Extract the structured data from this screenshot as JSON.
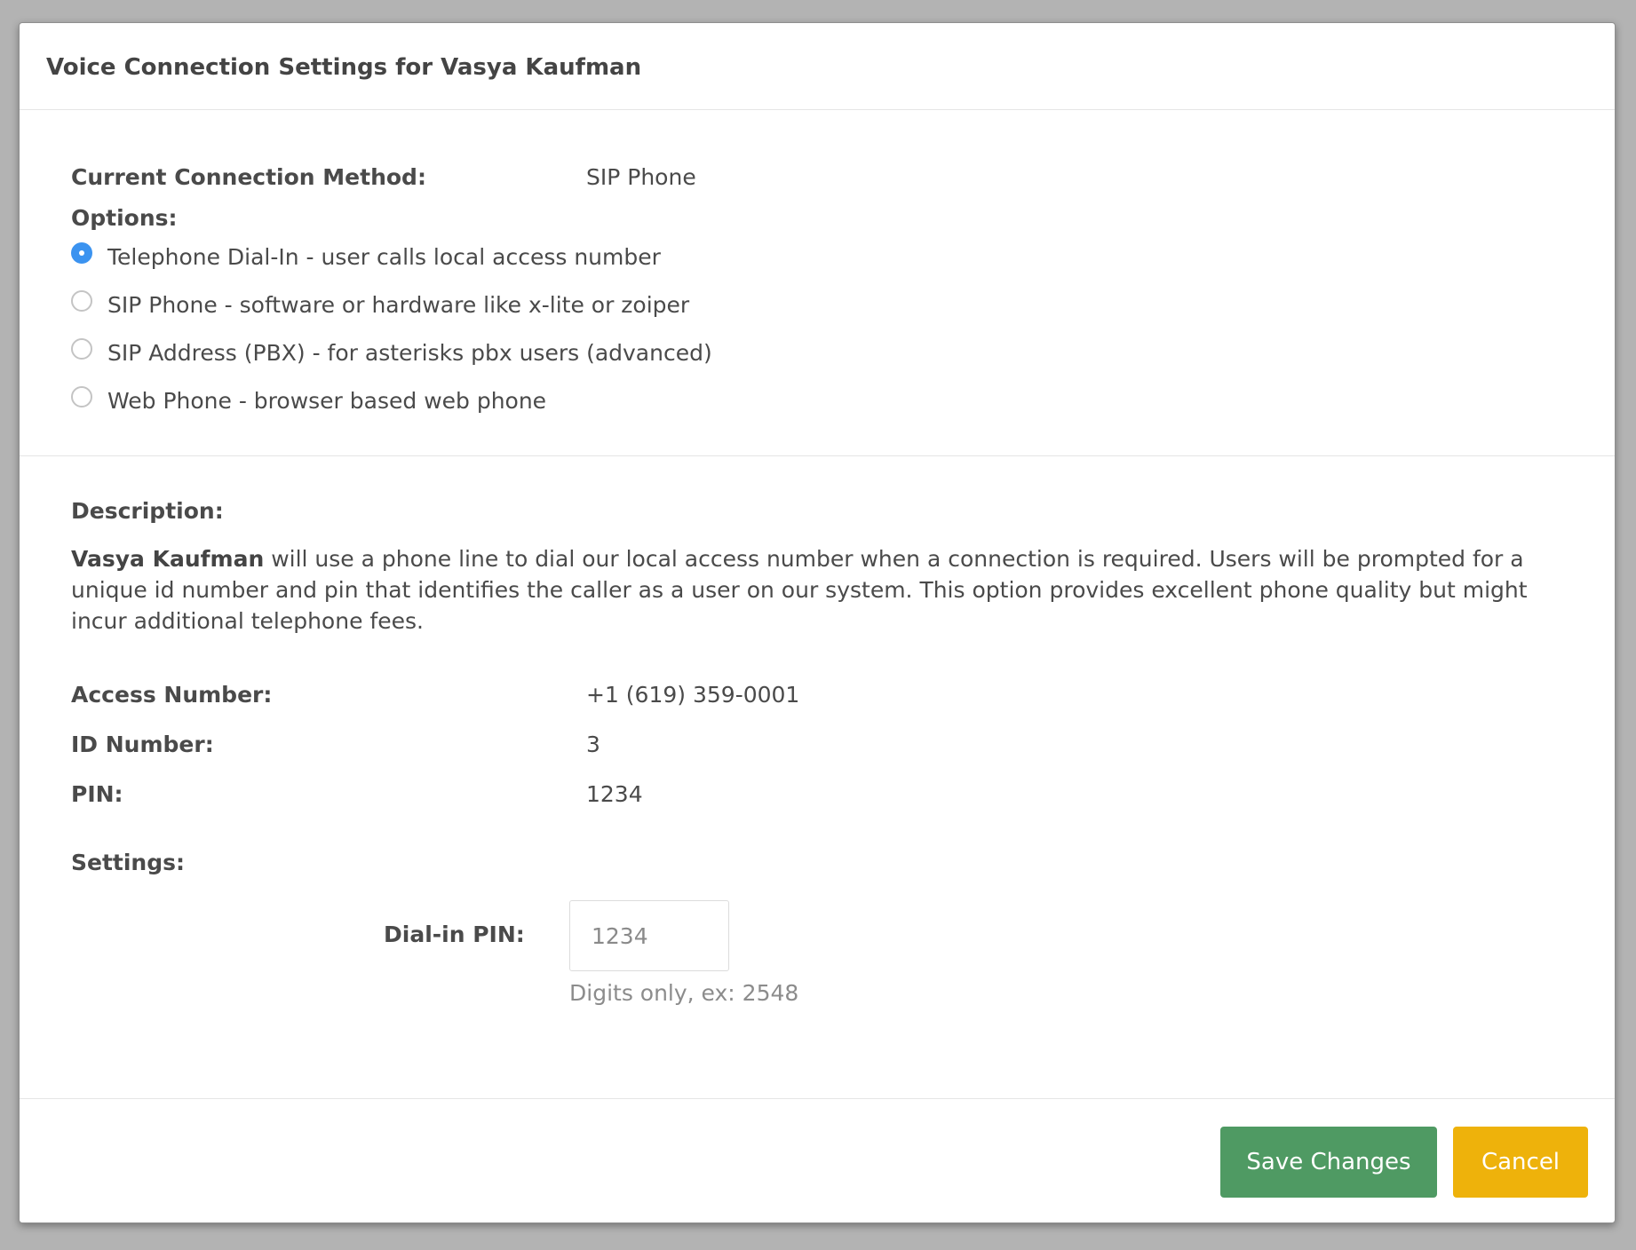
{
  "modal": {
    "title": "Voice Connection Settings for Vasya Kaufman"
  },
  "connection": {
    "current_label": "Current Connection Method:",
    "current_value": "SIP Phone",
    "options_label": "Options:",
    "options": [
      {
        "label": "Telephone Dial-In - user calls local access number",
        "selected": true
      },
      {
        "label": "SIP Phone - software or hardware like x-lite or zoiper",
        "selected": false
      },
      {
        "label": "SIP Address (PBX) - for asterisks pbx users (advanced)",
        "selected": false
      },
      {
        "label": "Web Phone - browser based web phone",
        "selected": false
      }
    ]
  },
  "description": {
    "heading": "Description:",
    "user_name": "Vasya Kaufman",
    "text": "will use a phone line to dial our local access number when a connection is required. Users will be prompted for a unique id number and pin that identifies the caller as a user on our system. This option provides excellent phone quality but might incur additional telephone fees.",
    "access_number_label": "Access Number:",
    "access_number_value": "+1 (619) 359-0001",
    "id_number_label": "ID Number:",
    "id_number_value": "3",
    "pin_label": "PIN:",
    "pin_value": "1234"
  },
  "settings": {
    "heading": "Settings:",
    "dialin_pin_label": "Dial-in PIN:",
    "dialin_pin_placeholder": "1234",
    "dialin_pin_help": "Digits only, ex: 2548"
  },
  "footer": {
    "save_label": "Save Changes",
    "cancel_label": "Cancel"
  },
  "colors": {
    "backdrop": "#b3b3b3",
    "radio_selected": "#3b93f0",
    "save_button": "#4f9a63",
    "cancel_button": "#eeb20b"
  }
}
